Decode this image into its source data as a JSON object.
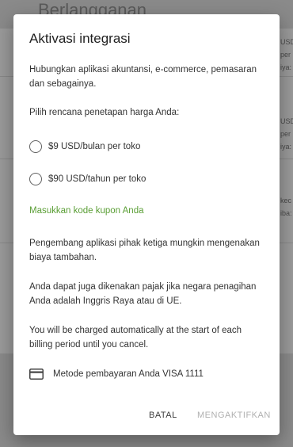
{
  "background": {
    "title": "Berlangganan",
    "snippets": [
      "USD",
      "per",
      "iya:",
      "USD",
      "per",
      "iya:",
      "kec",
      "iba:"
    ]
  },
  "dialog": {
    "title": "Aktivasi integrasi",
    "intro": "Hubungkan aplikasi akuntansi, e-commerce, pemasaran dan sebagainya.",
    "plan_prompt": "Pilih rencana penetapan harga Anda:",
    "plans": [
      {
        "label": "$9 USD/bulan per toko",
        "selected": false
      },
      {
        "label": "$90 USD/tahun per toko",
        "selected": false
      }
    ],
    "coupon_link": "Masukkan kode kupon Anda",
    "notice_fees": "Pengembang aplikasi pihak ketiga mungkin mengenakan biaya tambahan.",
    "notice_tax": "Anda dapat juga dikenakan pajak jika negara penagihan Anda adalah Inggris Raya atau di UE.",
    "notice_billing": "You will be charged automatically at the start of each billing period until you cancel.",
    "payment_method": "Metode pembayaran Anda VISA 1111",
    "cancel_label": "BATAL",
    "activate_label": "MENGAKTIFKAN"
  },
  "colors": {
    "accent_link": "#5a9e35",
    "disabled_button": "#b0b0b0"
  }
}
